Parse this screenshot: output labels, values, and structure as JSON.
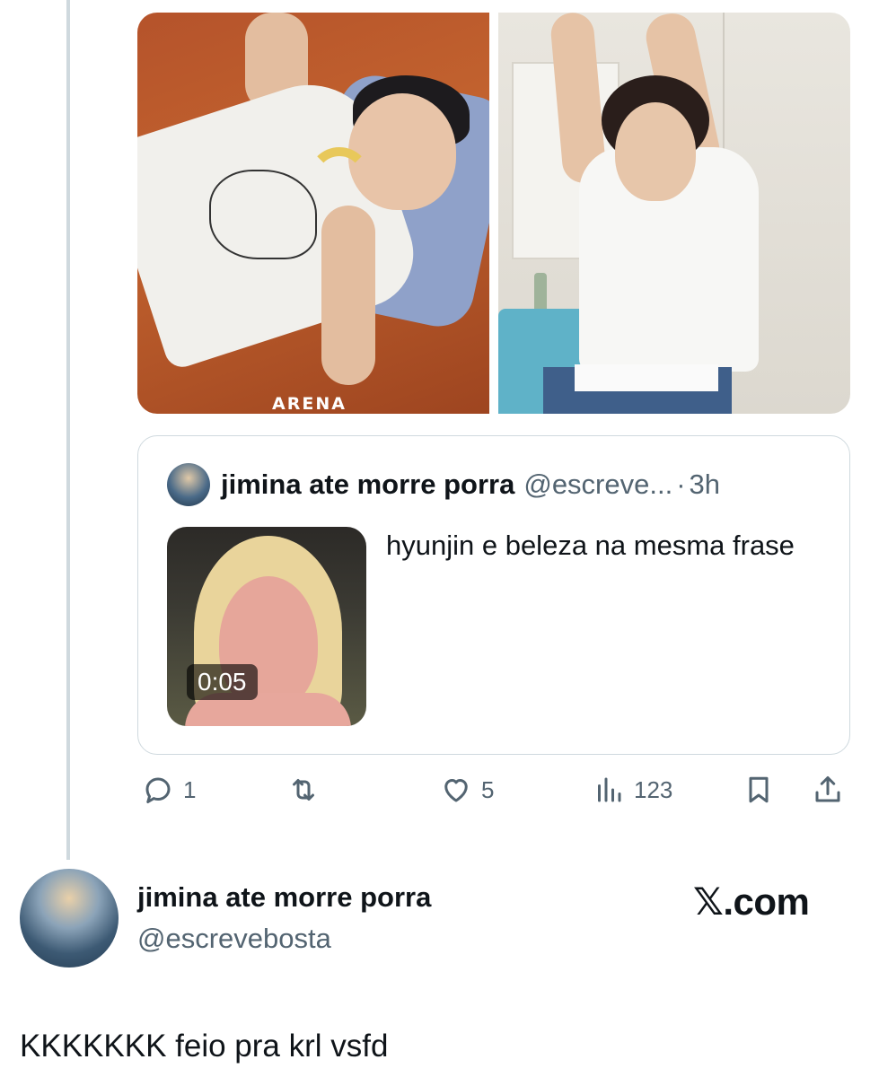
{
  "media": {
    "photo_left_brand": "ARENA"
  },
  "quoted_tweet": {
    "author_name": "jimina ate morre porra",
    "author_handle": "@escreve...",
    "separator": "·",
    "time": "3h",
    "text": "hyunjin e beleza na mesma frase",
    "video_duration": "0:05"
  },
  "actions": {
    "reply_count": "1",
    "like_count": "5",
    "views_count": "123",
    "icons": [
      "reply-icon",
      "retweet-icon",
      "like-icon",
      "views-icon",
      "bookmark-icon",
      "share-icon"
    ]
  },
  "reply": {
    "author_name": "jimina ate morre porra",
    "author_handle": "@escrevebosta",
    "source_x": "𝕏",
    "source_domain": ".com",
    "text": "KKKKKKK feio pra krl vsfd"
  },
  "colors": {
    "text_primary": "#0f1419",
    "text_secondary": "#536471",
    "border": "#cfd9de"
  }
}
